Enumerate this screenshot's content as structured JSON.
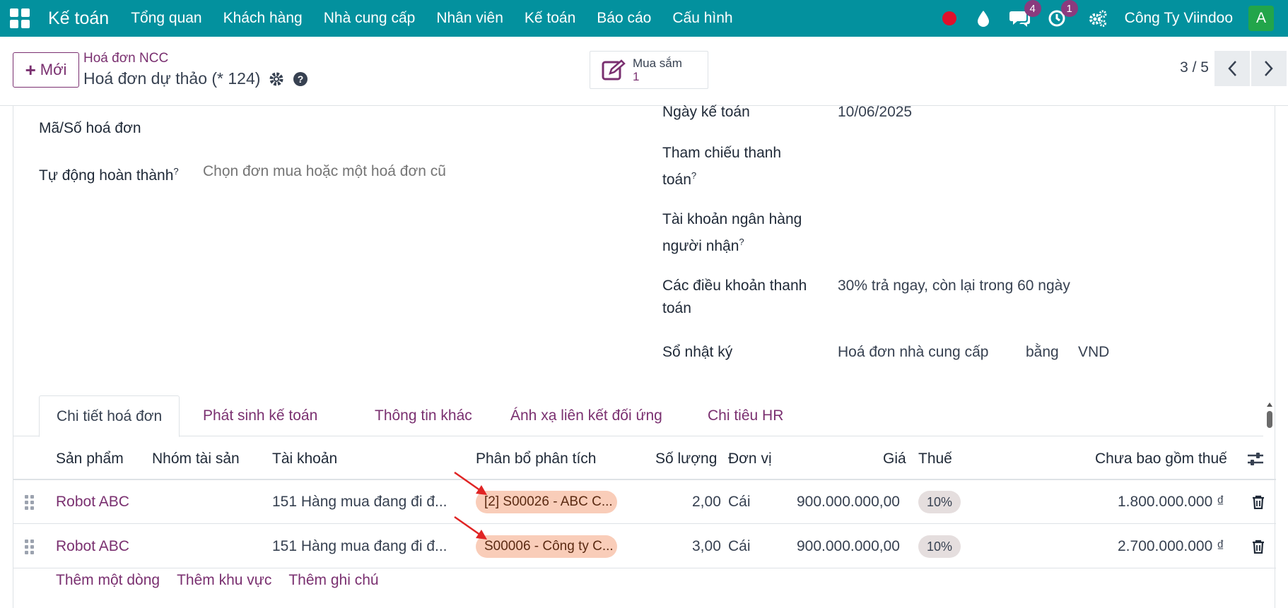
{
  "navbar": {
    "app_name": "Kế toán",
    "menu": [
      "Tổng quan",
      "Khách hàng",
      "Nhà cung cấp",
      "Nhân viên",
      "Kế toán",
      "Báo cáo",
      "Cấu hình"
    ],
    "messages_count": "4",
    "activities_count": "1",
    "company": "Công Ty Viindoo",
    "avatar_letter": "A",
    "colors": {
      "bar": "#03919e",
      "badge": "#8a3b7e",
      "avatar": "#22a54a",
      "record": "#e0102b"
    }
  },
  "control": {
    "new_label": "Mới",
    "breadcrumb": "Hoá đơn NCC",
    "record_title": "Hoá đơn dự thảo (* 124)",
    "smart_button": {
      "label": "Mua sắm",
      "value": "1",
      "icon": "edit-icon"
    },
    "pager": "3 / 5"
  },
  "form": {
    "left": {
      "invoice_number_label": "Mã/Số hoá đơn",
      "autocomplete_label": "Tự động hoàn thành",
      "autocomplete_placeholder": "Chọn đơn mua hoặc một hoá đơn cũ"
    },
    "right": {
      "accounting_date_label": "Ngày kế toán",
      "accounting_date_value": "10/06/2025",
      "payment_ref_label_1": "Tham chiếu thanh",
      "payment_ref_label_2": "toán",
      "bank_label_1": "Tài khoản ngân hàng",
      "bank_label_2": "người nhận",
      "terms_label_1": "Các điều khoản thanh",
      "terms_label_2": "toán",
      "terms_value": "30% trả ngay, còn lại trong 60 ngày",
      "journal_label": "Sổ nhật ký",
      "journal_value": "Hoá đơn nhà cung cấp",
      "currency_in": "bằng",
      "currency_value": "VND"
    }
  },
  "tabs": [
    "Chi tiết hoá đơn",
    "Phát sinh kế toán",
    "Thông tin khác",
    "Ánh xạ liên kết đối ứng",
    "Chi tiêu HR"
  ],
  "table": {
    "headers": [
      "Sản phẩm",
      "Nhóm tài sản",
      "Tài khoản",
      "Phân bổ phân tích",
      "Số lượng",
      "Đơn vị",
      "Giá",
      "Thuế",
      "Chưa bao gồm thuế"
    ],
    "rows": [
      {
        "product": "Robot ABC",
        "account": "151 Hàng mua đang đi đ...",
        "analytic": "[2] S00026 - ABC C...",
        "qty": "2,00",
        "uom": "Cái",
        "price": "900.000.000,00",
        "tax": "10%",
        "subtotal": "1.800.000.000 ₫"
      },
      {
        "product": "Robot ABC",
        "account": "151 Hàng mua đang đi đ...",
        "analytic": "S00006 - Công ty C...",
        "qty": "3,00",
        "uom": "Cái",
        "price": "900.000.000,00",
        "tax": "10%",
        "subtotal": "2.700.000.000 ₫"
      }
    ],
    "add_line": "Thêm một dòng",
    "add_section": "Thêm khu vực",
    "add_note": "Thêm ghi chú"
  },
  "help_mark": "?"
}
